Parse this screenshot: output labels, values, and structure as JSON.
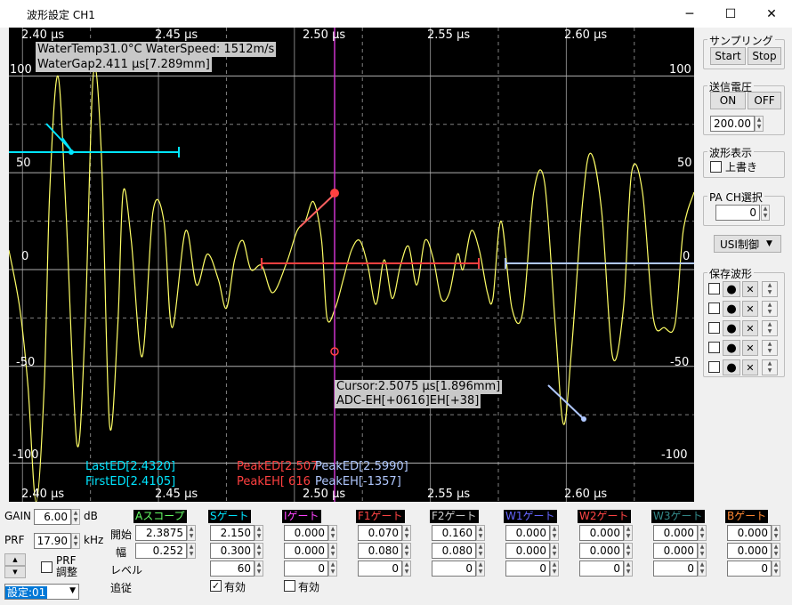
{
  "window": {
    "title": "波形設定 CH1",
    "minimize": "─",
    "maximize": "☐",
    "close": "✕"
  },
  "scope": {
    "x_ticks": [
      "2.40 μs",
      "2.45 μs",
      "2.50 μs",
      "2.55 μs",
      "2.60 μs"
    ],
    "y_left": [
      "100",
      "50",
      "0",
      "-50",
      "-100"
    ],
    "y_right": [
      "100",
      "50",
      "0",
      "-50",
      "-100"
    ],
    "water_info": "WaterTemp31.0°C WaterSpeed: 1512m/s",
    "water_gap": "WaterGap2.411 μs[7.289mm]",
    "cursor_line1": "Cursor:2.5075 μs[1.896mm]",
    "cursor_line2": "ADC-EH[+0616]EH[+38]",
    "last_ed": "LastED[2.4320]",
    "first_ed": "FirstED[2.4105]",
    "peak_ed_red": "PeakED[2.507",
    "peak_eh_red": "PeakEH[ 616",
    "peak_ed_blue": "PeakED[2.5990]",
    "peak_eh_blue": "PeakEH[-1357]",
    "colors": {
      "waveform": "#ffff66",
      "cursor": "#cc33cc",
      "cyan": "#00e5ff",
      "red": "#ff4040",
      "lightblue": "#b0c8ff",
      "grid": "#808080"
    }
  },
  "chart_data": {
    "type": "line",
    "xlim": [
      2.395,
      2.647
    ],
    "ylim": [
      -120,
      125
    ],
    "x_unit": "μs",
    "series": [
      {
        "points": [
          [
            2.395,
            10
          ],
          [
            2.399,
            -20
          ],
          [
            2.402,
            -60
          ],
          [
            2.405,
            -120
          ],
          [
            2.408,
            -60
          ],
          [
            2.41,
            40
          ],
          [
            2.413,
            100
          ],
          [
            2.416,
            30
          ],
          [
            2.42,
            -90
          ],
          [
            2.423,
            -30
          ],
          [
            2.426,
            100
          ],
          [
            2.429,
            60
          ],
          [
            2.432,
            -80
          ],
          [
            2.435,
            -30
          ],
          [
            2.437,
            40
          ],
          [
            2.44,
            15
          ],
          [
            2.444,
            -45
          ],
          [
            2.448,
            30
          ],
          [
            2.452,
            25
          ],
          [
            2.455,
            -30
          ],
          [
            2.46,
            20
          ],
          [
            2.464,
            -8
          ],
          [
            2.468,
            8
          ],
          [
            2.472,
            -5
          ],
          [
            2.475,
            -20
          ],
          [
            2.478,
            5
          ],
          [
            2.481,
            15
          ],
          [
            2.484,
            0
          ],
          [
            2.488,
            2
          ],
          [
            2.492,
            -12
          ],
          [
            2.497,
            3
          ],
          [
            2.501,
            20
          ],
          [
            2.504,
            25
          ],
          [
            2.507,
            35
          ],
          [
            2.51,
            15
          ],
          [
            2.512,
            -25
          ],
          [
            2.515,
            -20
          ],
          [
            2.518,
            -5
          ],
          [
            2.521,
            10
          ],
          [
            2.524,
            15
          ],
          [
            2.527,
            2
          ],
          [
            2.53,
            -18
          ],
          [
            2.533,
            5
          ],
          [
            2.536,
            -15
          ],
          [
            2.539,
            2
          ],
          [
            2.542,
            12
          ],
          [
            2.545,
            -8
          ],
          [
            2.548,
            15
          ],
          [
            2.551,
            6
          ],
          [
            2.554,
            -15
          ],
          [
            2.557,
            -12
          ],
          [
            2.56,
            8
          ],
          [
            2.562,
            0
          ],
          [
            2.565,
            20
          ],
          [
            2.568,
            10
          ],
          [
            2.571,
            -12
          ],
          [
            2.573,
            -15
          ],
          [
            2.576,
            25
          ],
          [
            2.58,
            -20
          ],
          [
            2.584,
            -22
          ],
          [
            2.588,
            40
          ],
          [
            2.592,
            45
          ],
          [
            2.596,
            -30
          ],
          [
            2.599,
            -80
          ],
          [
            2.602,
            -40
          ],
          [
            2.606,
            35
          ],
          [
            2.609,
            60
          ],
          [
            2.613,
            30
          ],
          [
            2.617,
            -45
          ],
          [
            2.621,
            -20
          ],
          [
            2.624,
            50
          ],
          [
            2.628,
            40
          ],
          [
            2.632,
            -25
          ],
          [
            2.636,
            -30
          ],
          [
            2.64,
            -28
          ],
          [
            2.643,
            20
          ],
          [
            2.647,
            40
          ]
        ]
      }
    ]
  },
  "sampling": {
    "label": "サンプリング",
    "start": "Start",
    "stop": "Stop"
  },
  "voltage": {
    "label": "送信電圧",
    "on": "ON",
    "off": "OFF",
    "value": "200.00"
  },
  "display": {
    "label": "波形表示",
    "overwrite": "上書き"
  },
  "pa": {
    "label": "PA CH選択",
    "value": "0"
  },
  "usi": {
    "label": "USI制御"
  },
  "saved": {
    "label": "保存波形",
    "close": "✕"
  },
  "bottom": {
    "gain_label": "GAIN",
    "gain_value": "6.00",
    "gain_unit": "dB",
    "prf_label": "PRF",
    "prf_value": "17.90",
    "prf_unit": "kHz",
    "prf_adjust": "PRF 調整",
    "preset": "設定:01",
    "row_start": "開始",
    "row_width": "幅",
    "row_level": "レベル",
    "row_track": "追従",
    "valid": "有効",
    "gates": [
      {
        "name": "Aスコープ",
        "color": "#66ff66",
        "start": "2.3875",
        "width": "0.252",
        "level": "",
        "check": ""
      },
      {
        "name": "Sゲート",
        "color": "#00e5ff",
        "start": "2.150",
        "width": "0.300",
        "level": "60",
        "check": "✓"
      },
      {
        "name": "Iゲート",
        "color": "#ff44ff",
        "start": "0.000",
        "width": "0.000",
        "level": "0",
        "check": ""
      },
      {
        "name": "F1ゲート",
        "color": "#ff4444",
        "start": "0.070",
        "width": "0.080",
        "level": "0",
        "check": ""
      },
      {
        "name": "F2ゲート",
        "color": "#cccccc",
        "start": "0.160",
        "width": "0.080",
        "level": "0",
        "check": ""
      },
      {
        "name": "W1ゲート",
        "color": "#6666ff",
        "start": "0.000",
        "width": "0.000",
        "level": "0",
        "check": ""
      },
      {
        "name": "W2ゲート",
        "color": "#ff4444",
        "start": "0.000",
        "width": "0.000",
        "level": "0",
        "check": ""
      },
      {
        "name": "W3ゲート",
        "color": "#338888",
        "start": "0.000",
        "width": "0.000",
        "level": "0",
        "check": ""
      },
      {
        "name": "Bゲート",
        "color": "#ff8833",
        "start": "0.000",
        "width": "0.000",
        "level": "0",
        "check": ""
      }
    ]
  }
}
